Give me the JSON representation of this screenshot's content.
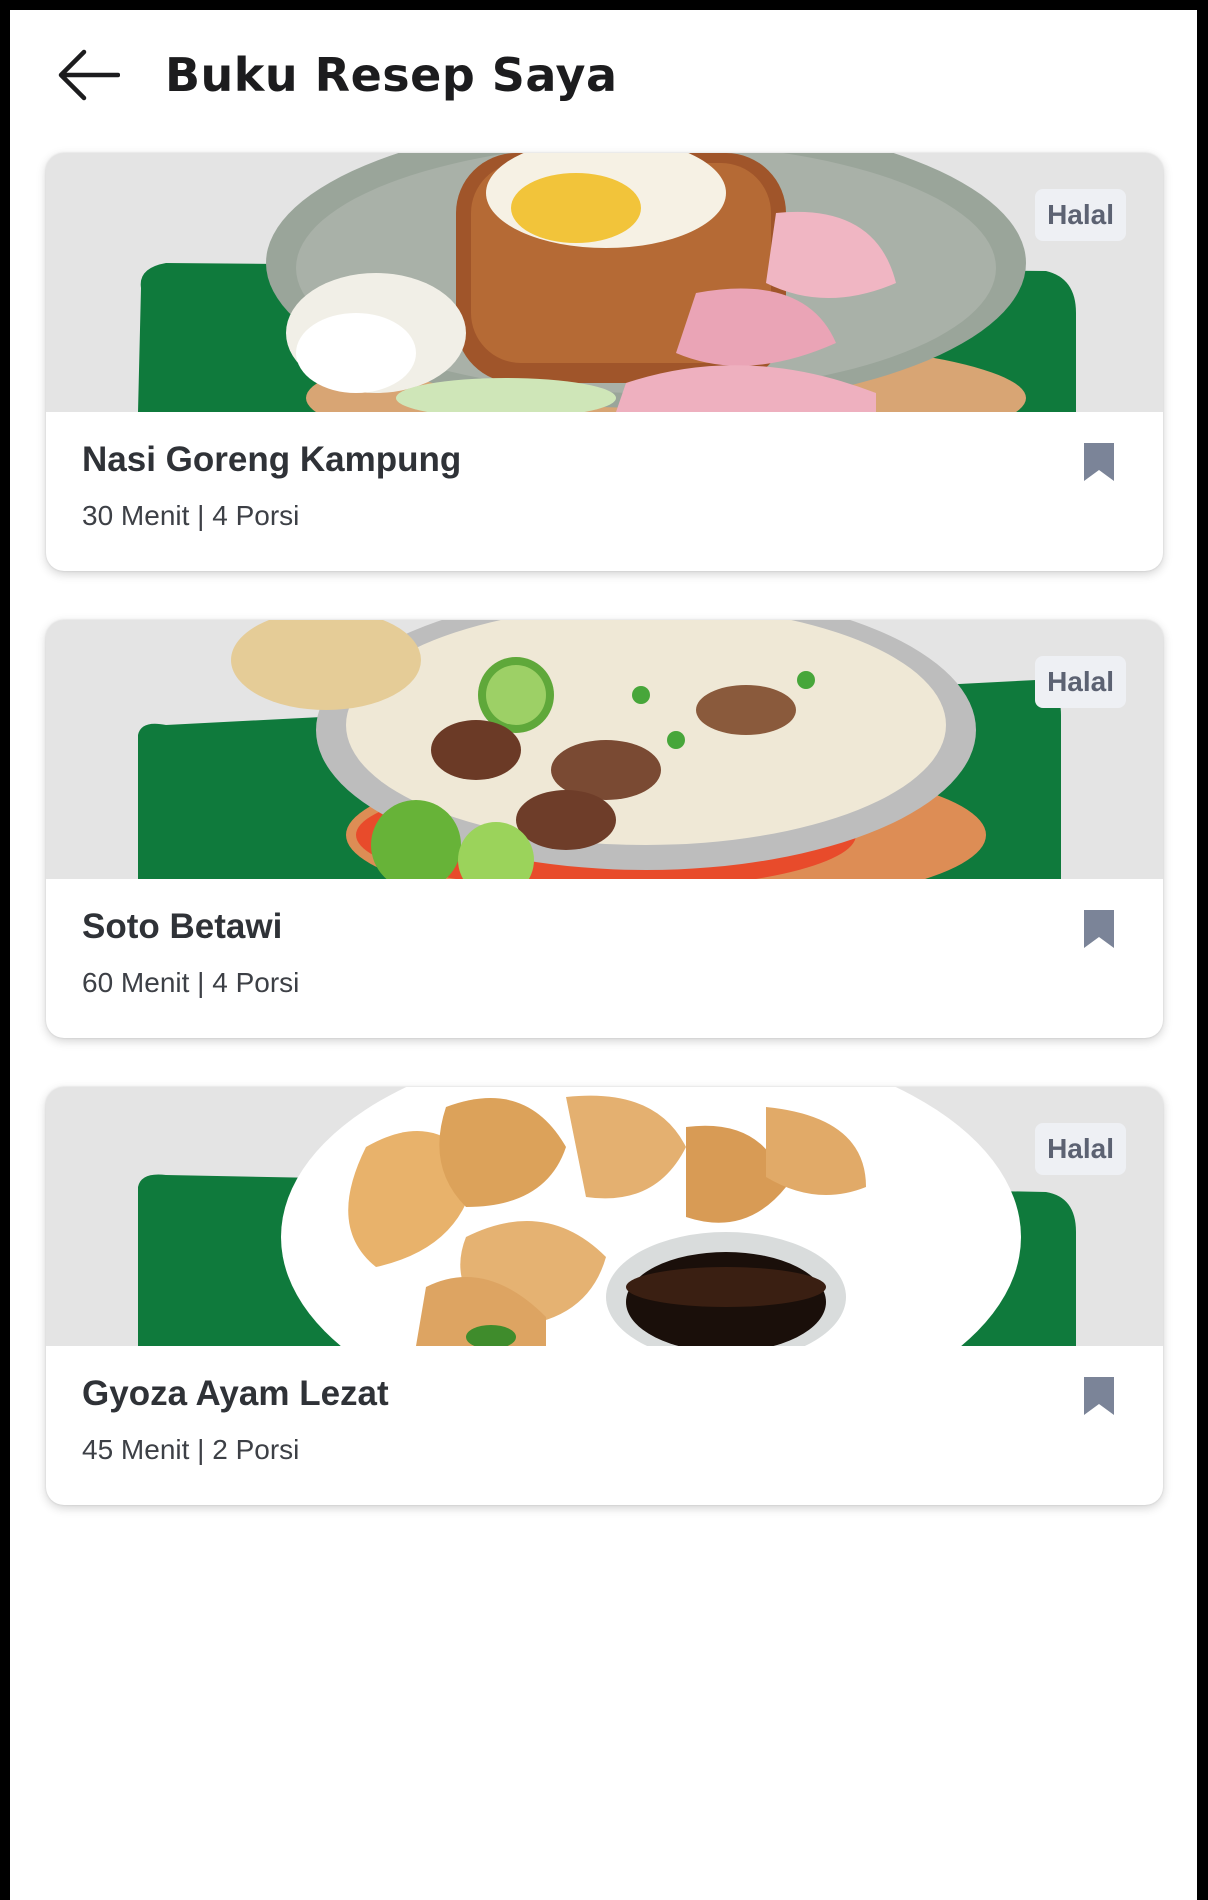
{
  "header": {
    "title": "Buku Resep Saya",
    "back_icon": "arrow-left-icon"
  },
  "recipes": [
    {
      "title": "Nasi Goreng Kampung",
      "meta": "30 Menit | 4 Porsi",
      "badge": "Halal",
      "bookmarked": true,
      "image": "nasi-goreng-photo"
    },
    {
      "title": "Soto Betawi",
      "meta": "60 Menit | 4 Porsi",
      "badge": "Halal",
      "bookmarked": true,
      "image": "soto-betawi-photo"
    },
    {
      "title": "Gyoza Ayam Lezat",
      "meta": "45 Menit | 2 Porsi",
      "badge": "Halal",
      "bookmarked": true,
      "image": "gyoza-photo"
    }
  ],
  "colors": {
    "background": "#ffffff",
    "brand_green": "#0f7a3c",
    "badge_bg": "#eef0f4",
    "badge_text": "#5c6272",
    "bookmark": "#7b8498",
    "title_text": "#2f3237"
  }
}
